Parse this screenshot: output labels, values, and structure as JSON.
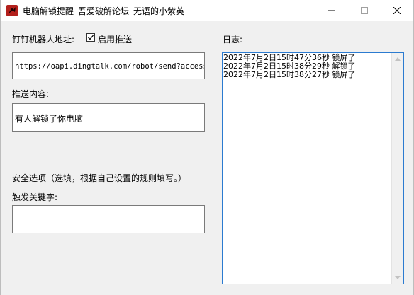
{
  "window": {
    "title": "电脑解锁提醒_吾爱破解论坛_无语的小紫英",
    "minimize_icon": "minimize-icon",
    "maximize_icon": "maximize-icon",
    "close_icon": "close-icon"
  },
  "form": {
    "robot_url_label": "钉钉机器人地址:",
    "robot_url_value": "https://oapi.dingtalk.com/robot/send?access_token",
    "enable_push_label": "启用推送",
    "enable_push_checked": true,
    "push_content_label": "推送内容:",
    "push_content_value": "有人解锁了你电脑",
    "security_label": "安全选项（选填，根据自己设置的规则填写。）",
    "keyword_label": "触发关键字:",
    "keyword_value": ""
  },
  "log": {
    "label": "日志:",
    "entries": [
      "2022年7月2日15时47分36秒 锁屏了",
      "2022年7月2日15时38分29秒 解锁了",
      "2022年7月2日15时38分27秒 锁屏了"
    ]
  }
}
